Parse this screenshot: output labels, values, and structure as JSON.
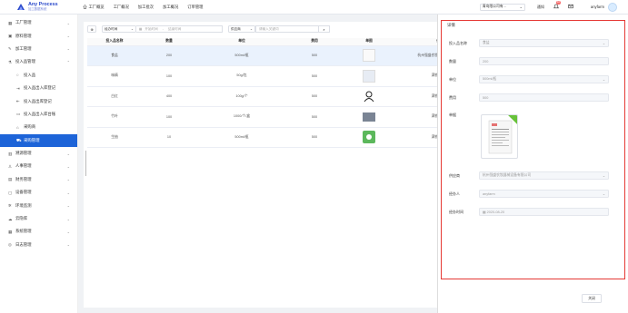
{
  "app": {
    "title": "Any Process",
    "subtitle": "加工数据系统"
  },
  "nav_tabs": [
    "工厂概览",
    "工厂概况",
    "加工批次",
    "加工概况",
    "订单管理"
  ],
  "topbar": {
    "factory_select": "青岛限公司有...",
    "notif_label": "通知",
    "badge_count": "10",
    "user_name": "anyfarm"
  },
  "sidebar": {
    "items": [
      {
        "label": "工厂管理",
        "icon": "grid-icon",
        "caret": "⌄"
      },
      {
        "label": "原料管理",
        "icon": "box-icon",
        "caret": "⌄"
      },
      {
        "label": "加工管理",
        "icon": "tool-icon",
        "caret": "⌄"
      },
      {
        "label": "投入品管理",
        "icon": "flask-icon",
        "caret": "⌃"
      },
      {
        "label": "投入品",
        "icon": "circle-icon",
        "sub": true
      },
      {
        "label": "投入品出入库登记",
        "icon": "login-icon",
        "sub": true
      },
      {
        "label": "投入品出库登记",
        "icon": "logout-icon",
        "sub": true
      },
      {
        "label": "投入品出入库台账",
        "icon": "ledger-icon",
        "sub": true
      },
      {
        "label": "采购商",
        "icon": "shop-icon",
        "sub": true
      },
      {
        "label": "采购管理",
        "icon": "cart-icon",
        "sub": true,
        "active": true
      },
      {
        "label": "溯源管理",
        "icon": "barcode-icon",
        "caret": "⌄"
      },
      {
        "label": "人事管理",
        "icon": "user-icon",
        "caret": "⌄"
      },
      {
        "label": "财务管理",
        "icon": "wallet-icon",
        "caret": "⌄"
      },
      {
        "label": "设备管理",
        "icon": "device-icon",
        "caret": "⌄"
      },
      {
        "label": "环境监测",
        "icon": "gear-icon",
        "caret": "⌄"
      },
      {
        "label": "云隐库",
        "icon": "cloud-icon",
        "caret": "⌄"
      },
      {
        "label": "系统管理",
        "icon": "system-icon",
        "caret": "⌄"
      },
      {
        "label": "日志管理",
        "icon": "log-icon",
        "caret": "⌄"
      }
    ]
  },
  "filters": {
    "time_type": "经办时间",
    "start_placeholder": "开始时间",
    "dash": "-",
    "end_placeholder": "结束时间",
    "supplier_select": "供应商",
    "keyword_placeholder": "请输入关键词"
  },
  "table": {
    "headers": [
      "投入品名称",
      "数量",
      "单位",
      "费用",
      "单图",
      "供应商"
    ],
    "rows": [
      {
        "name": "食盐",
        "qty": "200",
        "unit": "500ml/瓶",
        "cost": "500",
        "supplier": "杭州强盛农牧器械设备有限公司"
      },
      {
        "name": "味精",
        "qty": "100",
        "unit": "50g/包",
        "cost": "500",
        "supplier": "满铁信息发货"
      },
      {
        "name": "白红",
        "qty": "400",
        "unit": "100g/个",
        "cost": "500",
        "supplier": "满铁信息发货"
      },
      {
        "name": "竹叶",
        "qty": "100",
        "unit": "1000/个/盒",
        "cost": "500",
        "supplier": "满铁信息发货"
      },
      {
        "name": "生抽",
        "qty": "10",
        "unit": "500ml/瓶",
        "cost": "500",
        "supplier": "满铁信息发货"
      }
    ]
  },
  "drawer": {
    "title": "详情",
    "fields": [
      {
        "label": "投入品名称",
        "value": "食盐"
      },
      {
        "label": "数量",
        "value": "200"
      },
      {
        "label": "单位",
        "value": "500ml/瓶"
      },
      {
        "label": "费用",
        "value": "500"
      },
      {
        "label": "单据",
        "value": ""
      },
      {
        "label": "供应商",
        "value": "杭州强盛农牧器械设备有限公司"
      },
      {
        "label": "经办人",
        "value": "anyfarm"
      },
      {
        "label": "经办时间",
        "value": "2020-08-20"
      }
    ],
    "close_button": "关闭"
  },
  "colors": {
    "brand": "#2b4acb",
    "active": "#1d64d8",
    "highlight_border": "#e53935"
  }
}
